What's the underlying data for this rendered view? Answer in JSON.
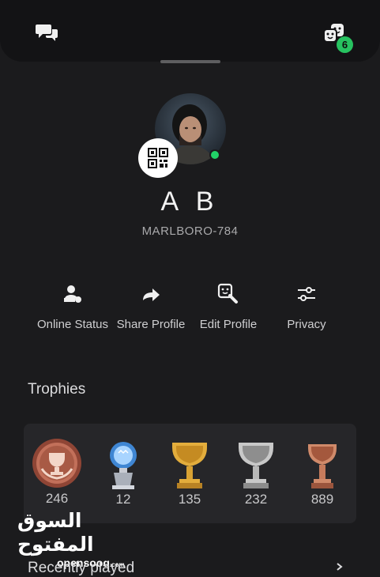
{
  "topbar": {
    "left_icon": "chat-bubbles-icon",
    "right_icon": "friends-faces-icon",
    "friends_badge": "6"
  },
  "profile": {
    "display_name": "A B",
    "online_id": "MARLBORO-784",
    "online_status_color": "#21d267",
    "qr_icon": "qr-code-icon"
  },
  "actions": [
    {
      "label": "Online Status",
      "icon": "online-status-icon"
    },
    {
      "label": "Share Profile",
      "icon": "share-arrow-icon"
    },
    {
      "label": "Edit Profile",
      "icon": "edit-profile-icon"
    },
    {
      "label": "Privacy",
      "icon": "sliders-icon"
    }
  ],
  "trophies": {
    "title": "Trophies",
    "items": [
      {
        "type": "level",
        "count": "246",
        "color": "#b05a44"
      },
      {
        "type": "platinum",
        "count": "12",
        "color": "#5aa0e0"
      },
      {
        "type": "gold",
        "count": "135",
        "color": "#d9a233"
      },
      {
        "type": "silver",
        "count": "232",
        "color": "#b8b8b8"
      },
      {
        "type": "bronze",
        "count": "889",
        "color": "#c67b5c"
      }
    ]
  },
  "watermark": {
    "arabic": "السوق المفتوح",
    "english": "opensooq",
    "suffix": ".com"
  },
  "recently_played": {
    "title": "Recently played"
  }
}
